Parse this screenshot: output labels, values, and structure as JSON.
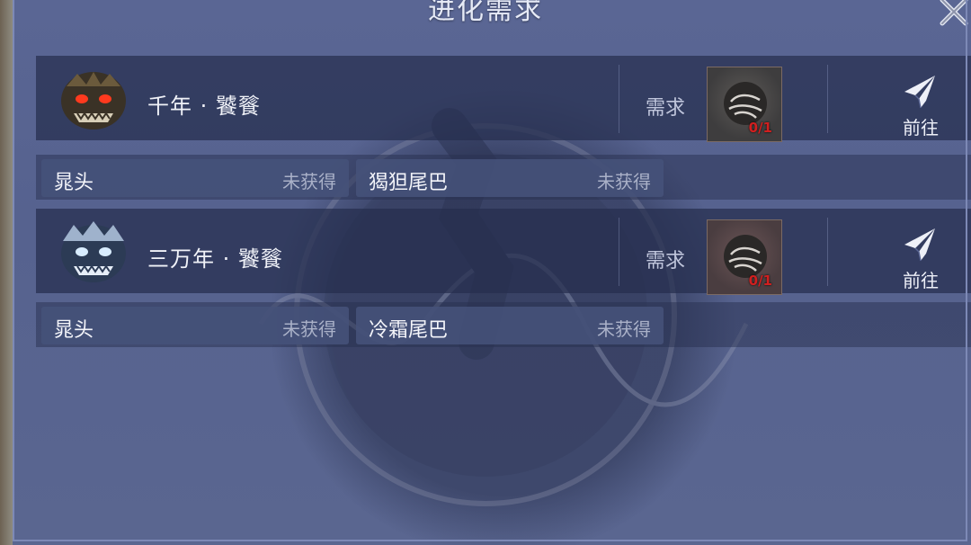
{
  "title": "进化需求",
  "requirements": [
    {
      "name": "千年 · 饕餮",
      "avatar_icon": "taotie-red-icon",
      "need_label": "需求",
      "item_count": "0/1",
      "goto_label": "前往",
      "parts": [
        {
          "name": "晁头",
          "status": "未获得"
        },
        {
          "name": "猲狚尾巴",
          "status": "未获得"
        }
      ]
    },
    {
      "name": "三万年 · 饕餮",
      "avatar_icon": "taotie-blue-icon",
      "need_label": "需求",
      "item_count": "0/1",
      "goto_label": "前往",
      "parts": [
        {
          "name": "晁头",
          "status": "未获得"
        },
        {
          "name": "冷霜尾巴",
          "status": "未获得"
        }
      ]
    }
  ],
  "colors": {
    "panel_bg": "#5a6694",
    "count_red": "#d11f1f"
  }
}
